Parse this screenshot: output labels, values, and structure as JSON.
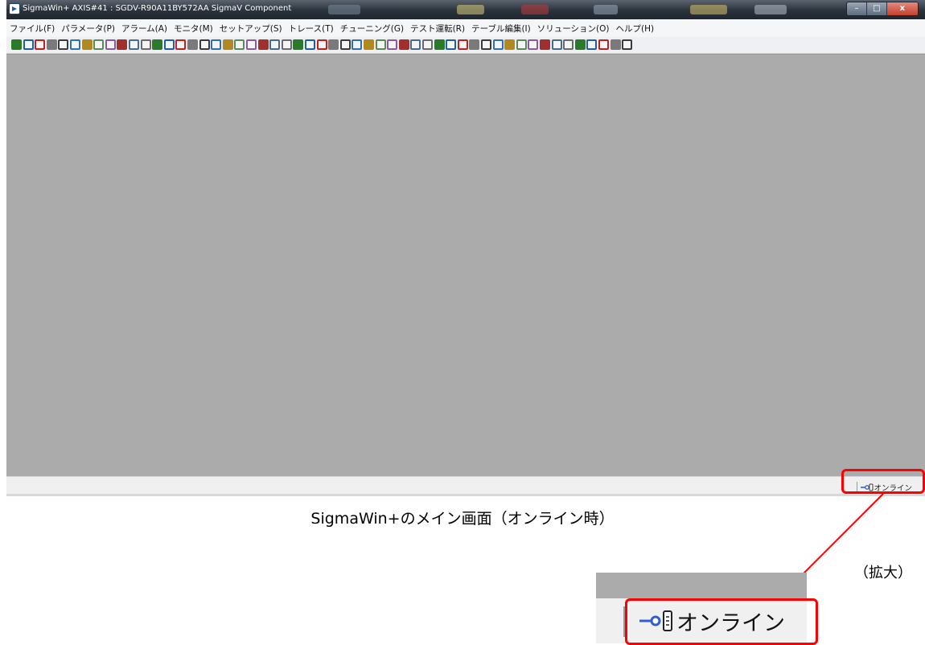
{
  "window": {
    "title": "SigmaWin+ AXIS#41 : SGDV-R90A11BY572AA SigmaV Component",
    "controls": [
      "–",
      "□",
      "x"
    ]
  },
  "menu": [
    "ファイル(F)",
    "パラメータ(P)",
    "アラーム(A)",
    "モニタ(M)",
    "セットアップ(S)",
    "トレース(T)",
    "チューニング(G)",
    "テスト運転(R)",
    "テーブル編集(I)",
    "ソリューション(O)",
    "ヘルプ(H)"
  ],
  "status": {
    "online_label": "オンライン"
  },
  "caption": "SigmaWin+のメイン画面（オンライン時）",
  "zoom_label": "（拡大）",
  "zoom": {
    "online_label": "オンライン"
  },
  "colors": {
    "highlight": "#ff0000",
    "workspace": "#ababab",
    "connection_icon": "#2f5fd8"
  },
  "icons": [
    "app-icon",
    "online-connection-icon",
    "arrow-icon"
  ]
}
